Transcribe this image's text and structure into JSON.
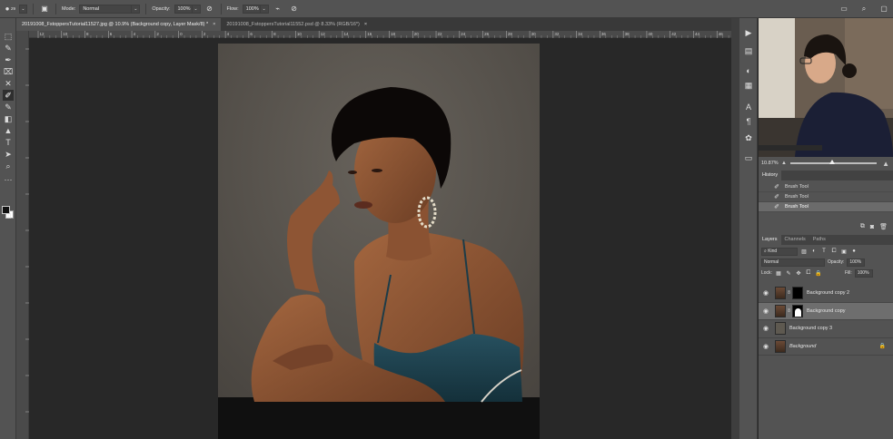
{
  "options_bar": {
    "brush_size": "29",
    "mode_label": "Mode:",
    "mode_value": "Normal",
    "opacity_label": "Opacity:",
    "opacity_value": "100%",
    "flow_label": "Flow:",
    "flow_value": "100%"
  },
  "tabs": [
    {
      "label": "20191008_FstoppersTutorial11527.jpg @ 10.9% (Background copy, Layer Mask/8) *",
      "close": "×"
    },
    {
      "label": "20191008_FstoppersTutorial11552.psd @ 8.33% (RGB/16*)",
      "close": "×"
    }
  ],
  "ruler_ticks": [
    "12",
    "10",
    "8",
    "6",
    "4",
    "2",
    "0",
    "2",
    "4",
    "6",
    "8",
    "10",
    "12",
    "14",
    "16",
    "18",
    "20",
    "22",
    "24",
    "26",
    "28",
    "30",
    "32",
    "34",
    "36",
    "38",
    "40",
    "42",
    "44",
    "46"
  ],
  "navigator": {
    "zoom": "10.87%",
    "zoom_fraction": 0.45
  },
  "history": {
    "tab": "History",
    "items": [
      {
        "label": "Brush Tool",
        "active": false
      },
      {
        "label": "Brush Tool",
        "active": false
      },
      {
        "label": "Brush Tool",
        "active": true
      }
    ]
  },
  "layers_panel": {
    "tabs": [
      "Layers",
      "Channels",
      "Paths"
    ],
    "filter": "Kind",
    "blend_mode": "Normal",
    "opacity_label": "Opacity:",
    "opacity_value": "100%",
    "lock_label": "Lock:",
    "fill_label": "Fill:",
    "fill_value": "100%",
    "layers": [
      {
        "name": "Background copy 2",
        "mask": "black",
        "active": false,
        "italic": false
      },
      {
        "name": "Background copy",
        "mask": "white",
        "active": true,
        "italic": false
      },
      {
        "name": "Background copy 3",
        "mask": "none",
        "active": false,
        "italic": false
      },
      {
        "name": "Background",
        "mask": "none",
        "active": false,
        "italic": true,
        "locked": true
      }
    ]
  },
  "colors": {
    "app_bg": "#282828",
    "panel": "#535353",
    "photo_bg": "#58544f",
    "skin": "#8a5536",
    "dress": "#1f3e4a"
  }
}
